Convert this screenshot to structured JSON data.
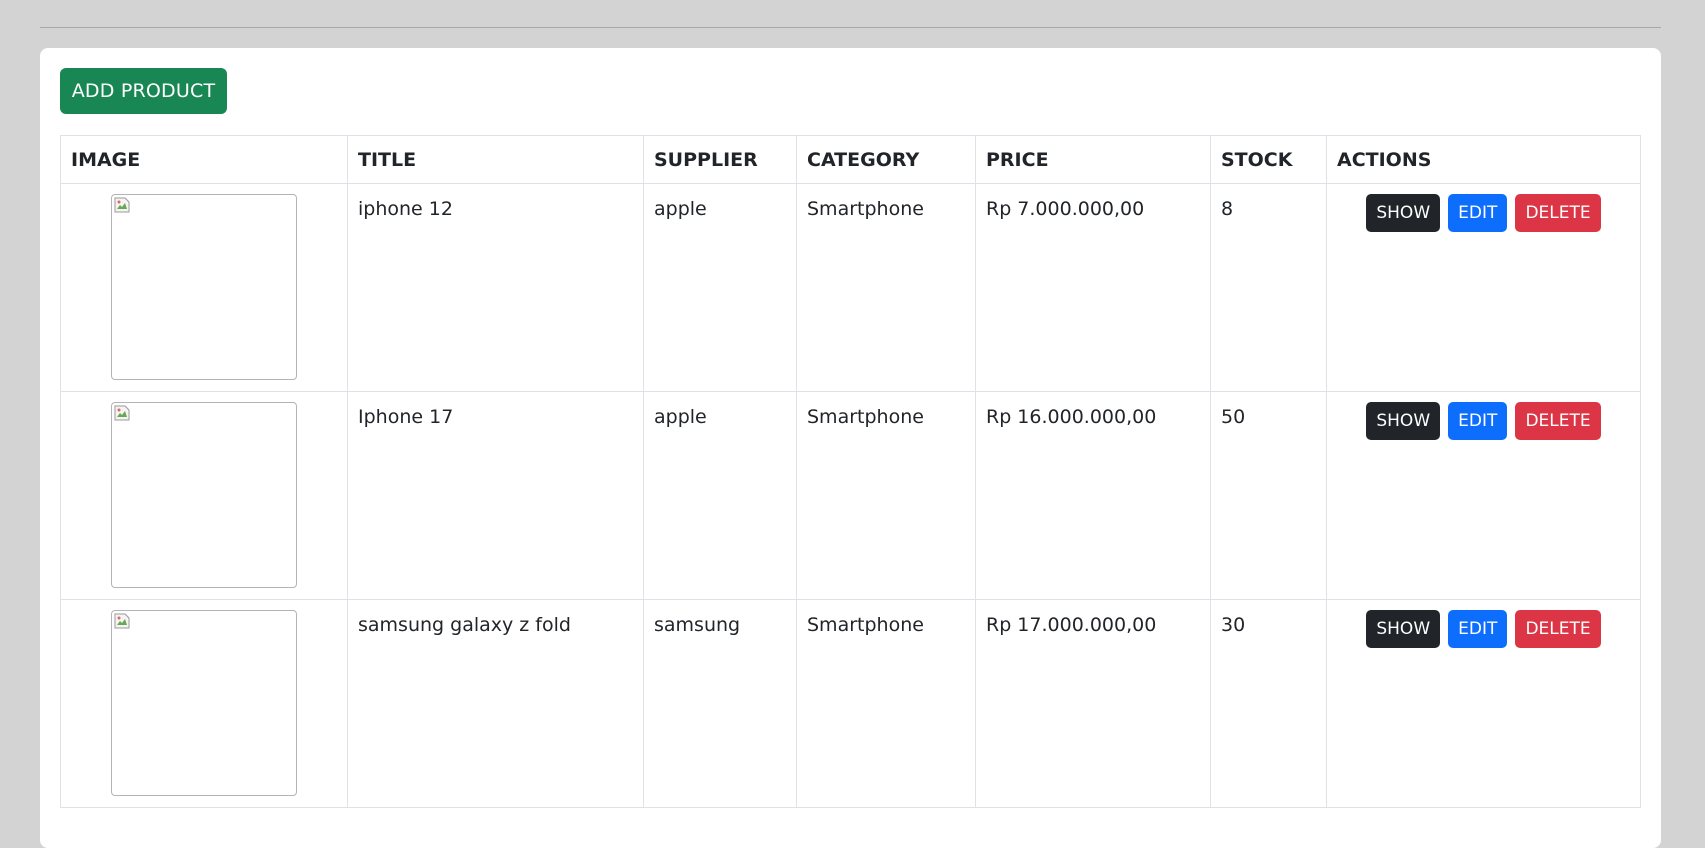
{
  "toolbar": {
    "add_label": "ADD PRODUCT"
  },
  "table": {
    "headers": [
      "IMAGE",
      "TITLE",
      "SUPPLIER",
      "CATEGORY",
      "PRICE",
      "STOCK",
      "ACTIONS"
    ],
    "rows": [
      {
        "title": "iphone 12",
        "supplier": "apple",
        "category": "Smartphone",
        "price": "Rp 7.000.000,00",
        "stock": "8"
      },
      {
        "title": "Iphone 17",
        "supplier": "apple",
        "category": "Smartphone",
        "price": "Rp 16.000.000,00",
        "stock": "50"
      },
      {
        "title": "samsung galaxy z fold",
        "supplier": "samsung",
        "category": "Smartphone",
        "price": "Rp 17.000.000,00",
        "stock": "30"
      }
    ]
  },
  "actions": {
    "show_label": "SHOW",
    "edit_label": "EDIT",
    "delete_label": "DELETE"
  },
  "colors": {
    "add": "#198754",
    "show": "#212529",
    "edit": "#0d6efd",
    "delete": "#dc3545"
  },
  "icons": {
    "image_placeholder": "broken-image-icon"
  }
}
